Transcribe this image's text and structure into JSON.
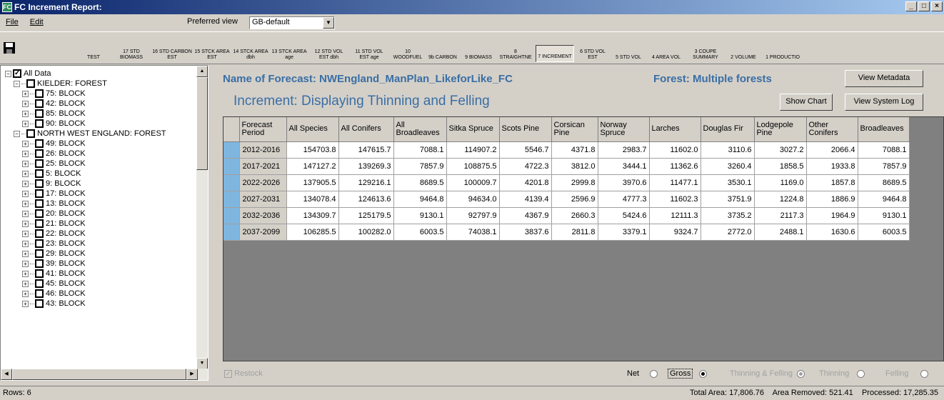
{
  "window": {
    "title": "FC  Increment Report:"
  },
  "menu": {
    "file": "File",
    "edit": "Edit"
  },
  "preferred_view": {
    "label": "Preferred view",
    "value": "GB-default"
  },
  "toolbar": [
    {
      "label": "TEST",
      "active": false
    },
    {
      "label": "17 STD BIOMASS",
      "active": false
    },
    {
      "label": "16 STD CARBON EST",
      "active": false
    },
    {
      "label": "15 STCK AREA EST",
      "active": false
    },
    {
      "label": "14 STCK AREA dbh",
      "active": false
    },
    {
      "label": "13 STCK AREA age",
      "active": false
    },
    {
      "label": "12 STD VOL EST dbh",
      "active": false
    },
    {
      "label": "11 STD VOL EST age",
      "active": false
    },
    {
      "label": "10 WOODFUEL",
      "active": false
    },
    {
      "label": "9b CARBON",
      "active": false
    },
    {
      "label": "9 BIOMASS",
      "active": false
    },
    {
      "label": "8 STRAIGHTNE",
      "active": false
    },
    {
      "label": "7 INCREMENT",
      "active": true
    },
    {
      "label": "6 STD VOL EST",
      "active": false
    },
    {
      "label": "5 STD VOL",
      "active": false
    },
    {
      "label": "4 AREA VOL",
      "active": false
    },
    {
      "label": "3 COUPE SUMMARY",
      "active": false
    },
    {
      "label": "2 VOLUME",
      "active": false
    },
    {
      "label": "1 PRODUCTIO",
      "active": false
    }
  ],
  "tree": [
    {
      "label": "All Data",
      "level": 0,
      "checked": true,
      "expander": "-"
    },
    {
      "label": "KIELDER: FOREST",
      "level": 1,
      "checked": false,
      "expander": "-"
    },
    {
      "label": "75: BLOCK",
      "level": 2,
      "checked": false,
      "expander": "+"
    },
    {
      "label": "42: BLOCK",
      "level": 2,
      "checked": false,
      "expander": "+"
    },
    {
      "label": "85: BLOCK",
      "level": 2,
      "checked": false,
      "expander": "+"
    },
    {
      "label": "90: BLOCK",
      "level": 2,
      "checked": false,
      "expander": "+"
    },
    {
      "label": "NORTH WEST ENGLAND: FOREST",
      "level": 1,
      "checked": false,
      "expander": "-"
    },
    {
      "label": "49: BLOCK",
      "level": 2,
      "checked": false,
      "expander": "+"
    },
    {
      "label": "26: BLOCK",
      "level": 2,
      "checked": false,
      "expander": "+"
    },
    {
      "label": "25: BLOCK",
      "level": 2,
      "checked": false,
      "expander": "+"
    },
    {
      "label": "5: BLOCK",
      "level": 2,
      "checked": false,
      "expander": "+"
    },
    {
      "label": "9: BLOCK",
      "level": 2,
      "checked": false,
      "expander": "+"
    },
    {
      "label": "17: BLOCK",
      "level": 2,
      "checked": false,
      "expander": "+"
    },
    {
      "label": "13: BLOCK",
      "level": 2,
      "checked": false,
      "expander": "+"
    },
    {
      "label": "20: BLOCK",
      "level": 2,
      "checked": false,
      "expander": "+"
    },
    {
      "label": "21: BLOCK",
      "level": 2,
      "checked": false,
      "expander": "+"
    },
    {
      "label": "22: BLOCK",
      "level": 2,
      "checked": false,
      "expander": "+"
    },
    {
      "label": "23: BLOCK",
      "level": 2,
      "checked": false,
      "expander": "+"
    },
    {
      "label": "29: BLOCK",
      "level": 2,
      "checked": false,
      "expander": "+"
    },
    {
      "label": "39: BLOCK",
      "level": 2,
      "checked": false,
      "expander": "+"
    },
    {
      "label": "41: BLOCK",
      "level": 2,
      "checked": false,
      "expander": "+"
    },
    {
      "label": "45: BLOCK",
      "level": 2,
      "checked": false,
      "expander": "+"
    },
    {
      "label": "46: BLOCK",
      "level": 2,
      "checked": false,
      "expander": "+"
    },
    {
      "label": "43: BLOCK",
      "level": 2,
      "checked": false,
      "expander": "+"
    }
  ],
  "header": {
    "forecast_name": "Name of Forecast:  NWEngland_ManPlan_LikeforLike_FC",
    "forest": "Forest:  Multiple forests",
    "increment_title": "Increment:  Displaying Thinning and Felling",
    "view_metadata": "View Metadata",
    "show_chart": "Show Chart",
    "view_system_log": "View System Log"
  },
  "table": {
    "columns": [
      "Forecast Period",
      "All Species",
      "All Conifers",
      "All Broadleaves",
      "Sitka Spruce",
      "Scots Pine",
      "Corsican Pine",
      "Norway Spruce",
      "Larches",
      "Douglas Fir",
      "Lodgepole Pine",
      "Other Conifers",
      "Broadleaves"
    ],
    "rows": [
      [
        "2012-2016",
        "154703.8",
        "147615.7",
        "7088.1",
        "114907.2",
        "5546.7",
        "4371.8",
        "2983.7",
        "11602.0",
        "3110.6",
        "3027.2",
        "2066.4",
        "7088.1"
      ],
      [
        "2017-2021",
        "147127.2",
        "139269.3",
        "7857.9",
        "108875.5",
        "4722.3",
        "3812.0",
        "3444.1",
        "11362.6",
        "3260.4",
        "1858.5",
        "1933.8",
        "7857.9"
      ],
      [
        "2022-2026",
        "137905.5",
        "129216.1",
        "8689.5",
        "100009.7",
        "4201.8",
        "2999.8",
        "3970.6",
        "11477.1",
        "3530.1",
        "1169.0",
        "1857.8",
        "8689.5"
      ],
      [
        "2027-2031",
        "134078.4",
        "124613.6",
        "9464.8",
        "94634.0",
        "4139.4",
        "2596.9",
        "4777.3",
        "11602.3",
        "3751.9",
        "1224.8",
        "1886.9",
        "9464.8"
      ],
      [
        "2032-2036",
        "134309.7",
        "125179.5",
        "9130.1",
        "92797.9",
        "4367.9",
        "2660.3",
        "5424.6",
        "12111.3",
        "3735.2",
        "2117.3",
        "1964.9",
        "9130.1"
      ],
      [
        "2037-2099",
        "106285.5",
        "100282.0",
        "6003.5",
        "74038.1",
        "3837.6",
        "2811.8",
        "3379.1",
        "9324.7",
        "2772.0",
        "2488.1",
        "1630.6",
        "6003.5"
      ]
    ]
  },
  "options": {
    "restock": "Restock",
    "net": "Net",
    "gross": "Gross",
    "thinning_felling": "Thinning & Felling",
    "thinning": "Thinning",
    "felling": "Felling"
  },
  "status": {
    "rows": "Rows: 6",
    "totals": "Total Area: 17,806.76    Area Removed: 521.41    Processed: 17,285.35"
  }
}
